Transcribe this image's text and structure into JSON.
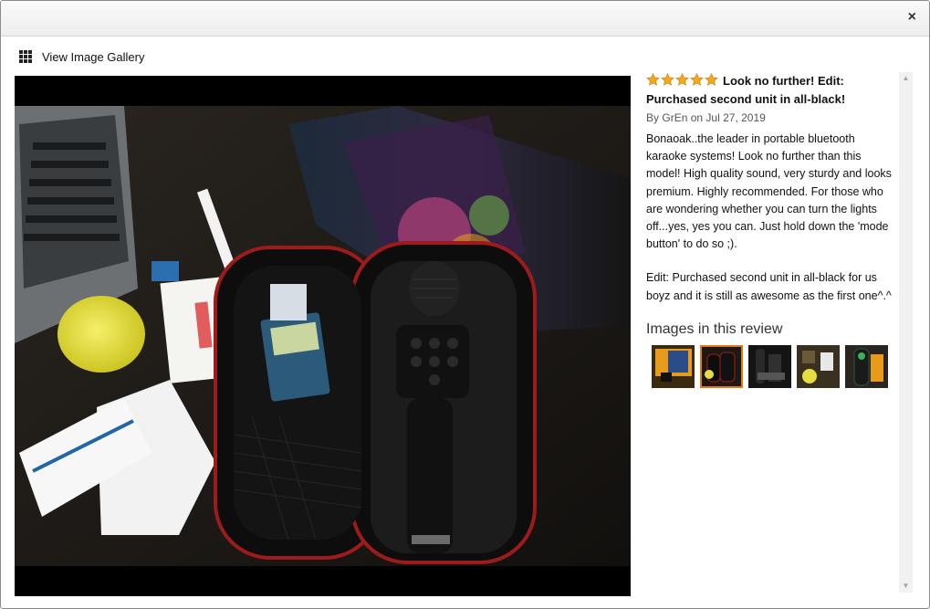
{
  "header": {
    "close_glyph": "×"
  },
  "gallery": {
    "label": "View Image Gallery",
    "icon": "grid-icon"
  },
  "review": {
    "rating": 5,
    "title": "Look no further! Edit: Purchased second unit in all-black!",
    "by_prefix": "By",
    "author": "GrEn",
    "date_prefix": "on",
    "date": "Jul 27, 2019",
    "paragraphs": [
      "Bonaoak..the leader in portable bluetooth karaoke systems! Look no further than this model! High quality sound, very sturdy and looks premium. Highly recommended. For those who are wondering whether you can turn the lights off...yes, yes you can. Just hold down the 'mode button' to do so ;).",
      "Edit: Purchased second unit in all-black for us boyz and it is still as awesome as the first one^.^"
    ]
  },
  "images_section": {
    "title": "Images in this review",
    "thumbnail_count": 5,
    "selected_index": 1
  },
  "colors": {
    "star": "#f5a623",
    "selected_border": "#e47911",
    "viewer_bg": "#000000"
  }
}
